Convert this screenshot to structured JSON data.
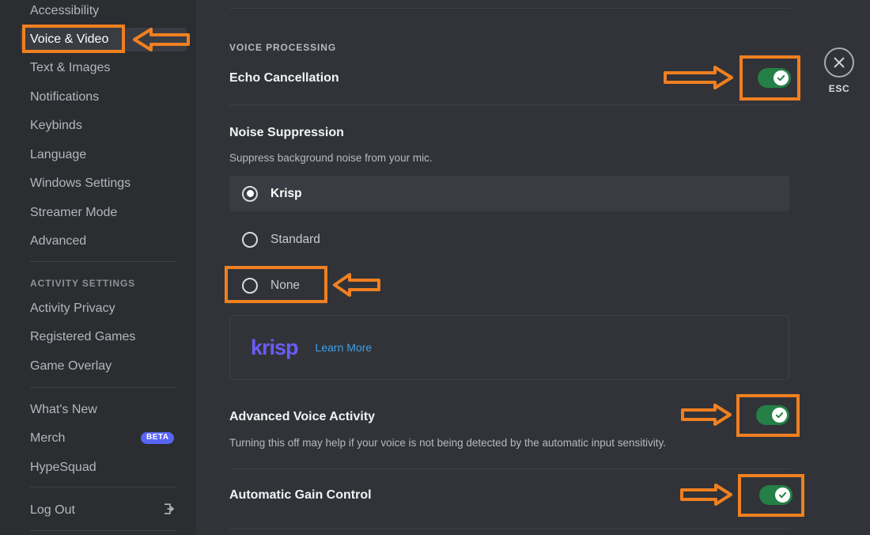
{
  "sidebar": {
    "items": [
      {
        "label": "Accessibility",
        "selected": false
      },
      {
        "label": "Voice & Video",
        "selected": true
      },
      {
        "label": "Text & Images",
        "selected": false
      },
      {
        "label": "Notifications",
        "selected": false
      },
      {
        "label": "Keybinds",
        "selected": false
      },
      {
        "label": "Language",
        "selected": false
      },
      {
        "label": "Windows Settings",
        "selected": false
      },
      {
        "label": "Streamer Mode",
        "selected": false
      },
      {
        "label": "Advanced",
        "selected": false
      }
    ],
    "activity_section_header": "ACTIVITY SETTINGS",
    "activity_items": [
      {
        "label": "Activity Privacy"
      },
      {
        "label": "Registered Games"
      },
      {
        "label": "Game Overlay"
      }
    ],
    "misc_items": [
      {
        "label": "What's New",
        "badge": ""
      },
      {
        "label": "Merch",
        "badge": "BETA"
      },
      {
        "label": "HypeSquad",
        "badge": ""
      }
    ],
    "logout": {
      "label": "Log Out",
      "icon": "logout-icon"
    }
  },
  "main": {
    "section_title": "VOICE PROCESSING",
    "echo_cancellation": {
      "title": "Echo Cancellation",
      "toggle_state": "on"
    },
    "noise_suppression": {
      "title": "Noise Suppression",
      "description": "Suppress background noise from your mic.",
      "options": [
        {
          "label": "Krisp",
          "selected": true
        },
        {
          "label": "Standard",
          "selected": false
        },
        {
          "label": "None",
          "selected": false
        }
      ],
      "card": {
        "logo_text": "krisp",
        "link_label": "Learn More"
      }
    },
    "advanced_voice_activity": {
      "title": "Advanced Voice Activity",
      "description": "Turning this off may help if your voice is not being detected by the automatic input sensitivity.",
      "toggle_state": "on"
    },
    "automatic_gain_control": {
      "title": "Automatic Gain Control",
      "toggle_state": "on"
    }
  },
  "close": {
    "icon": "close-icon",
    "label": "ESC"
  },
  "colors": {
    "accent_annotation": "#f08020",
    "toggle_on": "#248046",
    "badge": "#5865f2",
    "krisp_purple": "#6a5cf5",
    "link_blue": "#3f9fe8",
    "sidebar_bg": "#2b2d31",
    "main_bg": "#313338",
    "row_active_bg": "#3a3c43"
  }
}
